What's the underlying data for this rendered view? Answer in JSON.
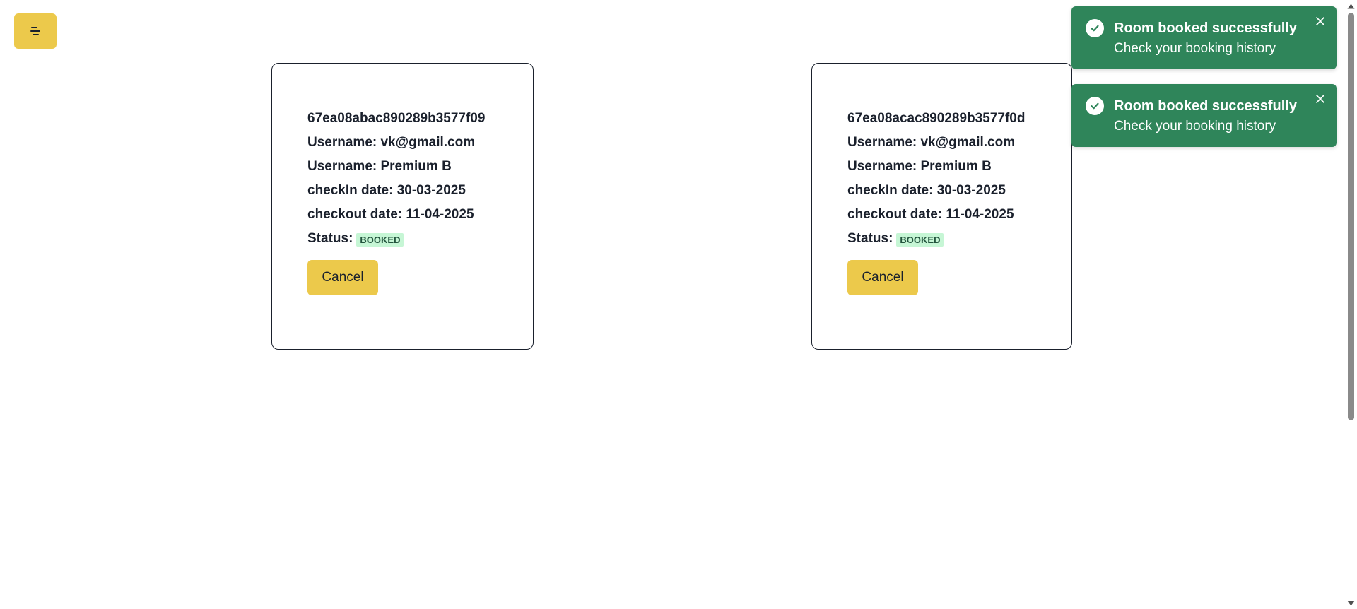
{
  "menu": {
    "icon": "hamburger-menu-icon"
  },
  "bookings": [
    {
      "id": "67ea08abac890289b3577f09",
      "username": "Username: vk@gmail.com",
      "room": "Username: Premium B",
      "checkin": "checkIn date: 30-03-2025",
      "checkout": "checkout date: 11-04-2025",
      "status_label": "Status:",
      "status_value": "BOOKED",
      "cancel_label": "Cancel"
    },
    {
      "id": "67ea08acac890289b3577f0d",
      "username": "Username: vk@gmail.com",
      "room": "Username: Premium B",
      "checkin": "checkIn date: 30-03-2025",
      "checkout": "checkout date: 11-04-2025",
      "status_label": "Status:",
      "status_value": "BOOKED",
      "cancel_label": "Cancel"
    }
  ],
  "toasts": [
    {
      "title": "Room booked successfully",
      "description": "Check your booking history",
      "icon": "check-circle-icon"
    },
    {
      "title": "Room booked successfully",
      "description": "Check your booking history",
      "icon": "check-circle-icon"
    }
  ],
  "colors": {
    "accent": "#ecc94b",
    "toast_bg": "#2f855a",
    "badge_bg": "#c6f6d5",
    "badge_text": "#22543d"
  }
}
